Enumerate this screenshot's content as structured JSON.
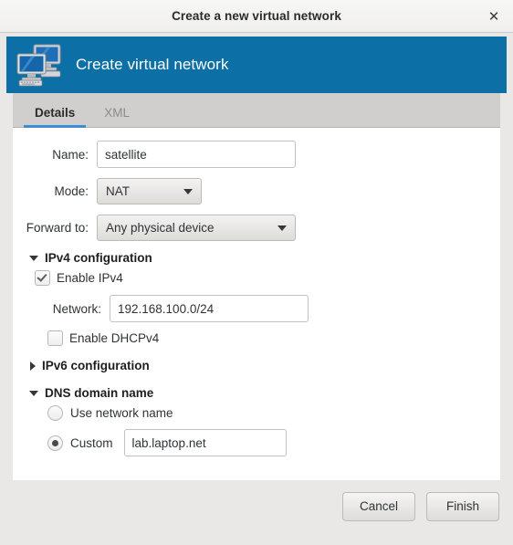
{
  "window": {
    "title": "Create a new virtual network",
    "close_icon": "close-icon"
  },
  "banner": {
    "title": "Create virtual network",
    "icon": "computers-icon",
    "color": "#0c6fa6"
  },
  "tabs": [
    {
      "label": "Details",
      "active": true
    },
    {
      "label": "XML",
      "active": false
    }
  ],
  "form": {
    "name_label": "Name:",
    "name_value": "satellite",
    "mode_label": "Mode:",
    "mode_value": "NAT",
    "forward_label": "Forward to:",
    "forward_value": "Any physical device"
  },
  "ipv4": {
    "section_label": "IPv4 configuration",
    "expanded": true,
    "enable_label": "Enable IPv4",
    "enable_checked": true,
    "network_label": "Network:",
    "network_value": "192.168.100.0/24",
    "network_invalid": true,
    "network_error_color": "#fdc1bd",
    "network_focus_color": "#5f9ed6",
    "dhcp_label": "Enable DHCPv4",
    "dhcp_checked": false
  },
  "ipv6": {
    "section_label": "IPv6 configuration",
    "expanded": false
  },
  "dns": {
    "section_label": "DNS domain name",
    "expanded": true,
    "use_network_name_label": "Use network name",
    "use_network_name_selected": false,
    "custom_label": "Custom",
    "custom_selected": true,
    "custom_value": "lab.laptop.net"
  },
  "footer": {
    "cancel_label": "Cancel",
    "finish_label": "Finish"
  },
  "theme": {
    "accent": "#3b8ed6",
    "banner_blue": "#0c6fa6"
  }
}
